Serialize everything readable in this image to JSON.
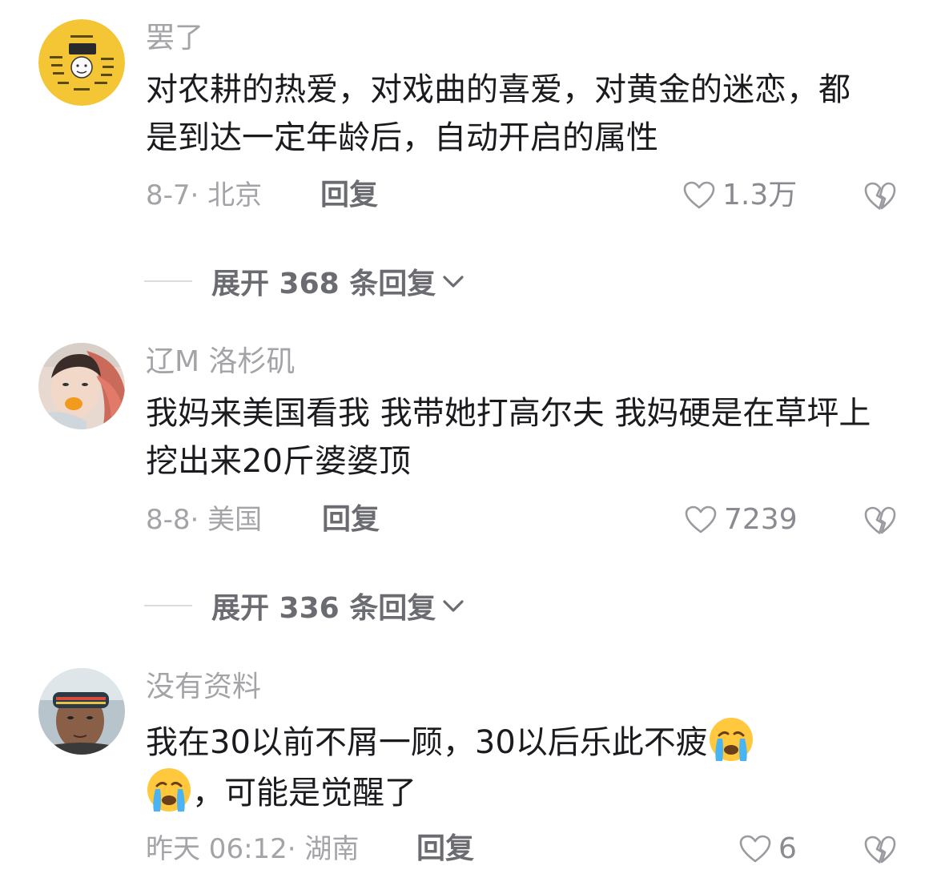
{
  "comments": [
    {
      "username": "罢了",
      "text": "对农耕的热爱，对戏曲的喜爱，对黄金的迷恋，都是到达一定年龄后，自动开启的属性",
      "meta": "8-7· 北京",
      "reply_label": "回复",
      "likes": "1.3万",
      "expand_text": "展开 368 条回复"
    },
    {
      "username": "辽M 洛杉矶",
      "text": "我妈来美国看我 我带她打高尔夫 我妈硬是在草坪上挖出来20斤婆婆顶",
      "meta": "8-8· 美国",
      "reply_label": "回复",
      "likes": "7239",
      "expand_text": "展开 336 条回复"
    },
    {
      "username": "没有资料",
      "text_part1": "我在30以前不屑一顾，30以后乐此不疲",
      "text_part2": "，可能是觉醒了",
      "meta": "昨天 06:12· 湖南",
      "reply_label": "回复",
      "likes": "6"
    }
  ],
  "icons": {
    "like": "heart-outline-icon",
    "dislike": "broken-heart-icon",
    "expand": "chevron-down-icon",
    "emoji": "crying-face-emoji"
  },
  "colors": {
    "text": "#1b1b1f",
    "muted": "#a3a3a8",
    "reply": "#6b6b72",
    "avatar1_bg": "#f4c534"
  }
}
